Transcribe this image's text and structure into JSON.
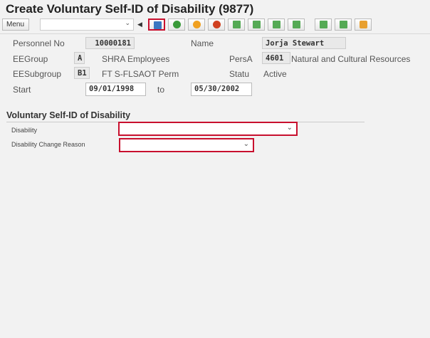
{
  "title": "Create Voluntary Self-ID of Disability (9877)",
  "toolbar": {
    "menu": "Menu",
    "command_value": "",
    "buttons": [
      "save",
      "back",
      "exit",
      "cancel",
      "previous",
      "first",
      "next",
      "last",
      "new",
      "copy",
      "overview"
    ]
  },
  "header": {
    "personnel_no_label": "Personnel No",
    "personnel_no": "10000181",
    "name_label": "Name",
    "name": "Jorja Stewart",
    "eegroup_label": "EEGroup",
    "eegroup": "A",
    "eegroup_text": "SHRA Employees",
    "persa_label": "PersA",
    "persa": "4601",
    "persa_text": "Natural and Cultural Resources",
    "eesubgroup_label": "EESubgroup",
    "eesubgroup": "B1",
    "eesubgroup_text": "FT S-FLSAOT Perm",
    "status_label": "Statu",
    "status": "Active",
    "start_label": "Start",
    "start": "09/01/1998",
    "to_label": "to",
    "end": "05/30/2002"
  },
  "section": {
    "title": "Voluntary Self-ID of Disability",
    "disability_label": "Disability",
    "disability_value": "",
    "reason_label": "Disability Change Reason",
    "reason_value": ""
  }
}
